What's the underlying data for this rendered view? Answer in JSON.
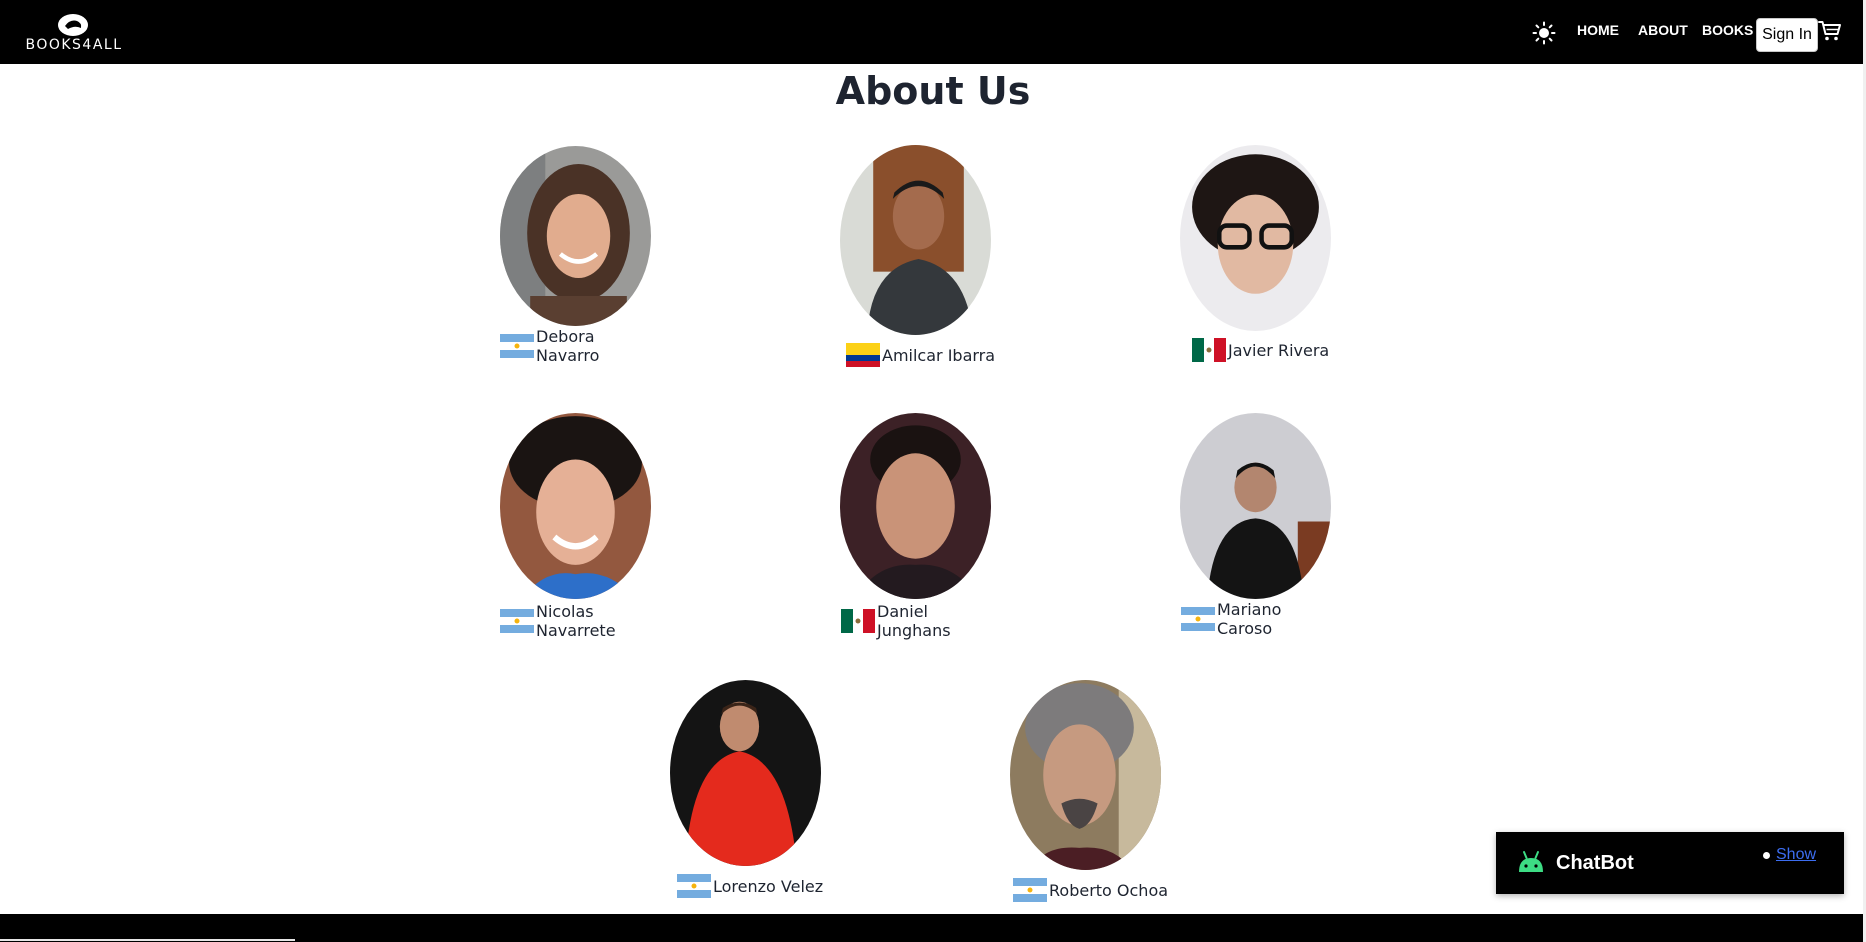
{
  "brand": {
    "logo_text": "BOOKS4ALL"
  },
  "nav": {
    "home": "HOME",
    "about": "ABOUT",
    "books": "BOOKS",
    "signin": "Sign In"
  },
  "page": {
    "title": "About Us"
  },
  "members": [
    {
      "name": "Debora Navarro",
      "flag": "argentina-flag"
    },
    {
      "name": "Amilcar Ibarra",
      "flag": "colombia-flag"
    },
    {
      "name": "Javier Rivera",
      "flag": "mexico-flag"
    },
    {
      "name": "Nicolas Navarrete",
      "flag": "argentina-flag"
    },
    {
      "name": "Daniel Junghans",
      "flag": "mexico-flag"
    },
    {
      "name": "Mariano Caroso",
      "flag": "argentina-flag"
    },
    {
      "name": "Lorenzo Velez",
      "flag": "argentina-flag"
    },
    {
      "name": "Roberto Ochoa",
      "flag": "argentina-flag"
    }
  ],
  "chatbot": {
    "title": "ChatBot",
    "show_label": "Show"
  },
  "colors": {
    "navbar_bg": "#000000",
    "title_text": "#1e2430",
    "chatbot_icon": "#3ddc84",
    "link": "#3c6df0"
  }
}
